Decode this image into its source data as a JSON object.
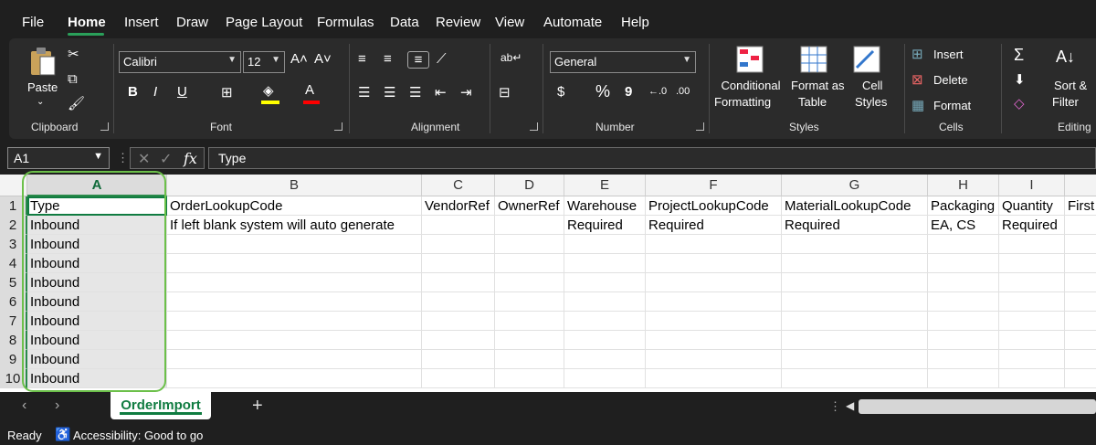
{
  "menu": {
    "items": [
      "File",
      "Home",
      "Insert",
      "Draw",
      "Page Layout",
      "Formulas",
      "Data",
      "Review",
      "View",
      "Automate",
      "Help"
    ],
    "active": "Home"
  },
  "ribbon": {
    "clipboard": {
      "paste_label": "Paste",
      "group_label": "Clipboard"
    },
    "font": {
      "font_name": "Calibri",
      "font_size": "12",
      "group_label": "Font",
      "bold": "B",
      "italic": "I",
      "underline": "U",
      "highlight_color": "#ffff00",
      "font_color": "#ff0000"
    },
    "alignment": {
      "group_label": "Alignment"
    },
    "number": {
      "format": "General",
      "currency": "$",
      "percent": "%",
      "comma": "9",
      "group_label": "Number"
    },
    "styles": {
      "conditional_formatting": [
        "Conditional",
        "Formatting"
      ],
      "format_as_table": [
        "Format as",
        "Table"
      ],
      "cell_styles": [
        "Cell",
        "Styles"
      ],
      "group_label": "Styles"
    },
    "cells": {
      "insert": "Insert",
      "delete": "Delete",
      "format": "Format",
      "group_label": "Cells"
    },
    "editing": {
      "sort_filter": [
        "Sort &",
        "Filter"
      ],
      "group_label": "Editing"
    }
  },
  "formula_bar": {
    "name_box": "A1",
    "fx_label": "fx",
    "content": "Type"
  },
  "grid": {
    "columns": [
      "A",
      "B",
      "C",
      "D",
      "E",
      "F",
      "G",
      "H",
      "I"
    ],
    "rows": [
      "1",
      "2",
      "3",
      "4",
      "5",
      "6",
      "7",
      "8",
      "9",
      "10"
    ],
    "headers": [
      "Type",
      "OrderLookupCode",
      "VendorRef",
      "OwnerRef",
      "Warehouse",
      "ProjectLookupCode",
      "MaterialLookupCode",
      "Packaging",
      "Quantity",
      "First"
    ],
    "row2": [
      "Inbound",
      "If left blank system will auto generate",
      "",
      "",
      "Required",
      "Required",
      "Required",
      "EA, CS",
      "Required"
    ],
    "colA": [
      "Inbound",
      "Inbound",
      "Inbound",
      "Inbound",
      "Inbound",
      "Inbound",
      "Inbound",
      "Inbound",
      "Inbound"
    ]
  },
  "sheet_tabs": {
    "active": "OrderImport",
    "add": "+"
  },
  "status": {
    "ready": "Ready",
    "accessibility": "Accessibility: Good to go"
  },
  "colors": {
    "accent": "#107c41",
    "highlight_ring": "#6cc04a"
  }
}
